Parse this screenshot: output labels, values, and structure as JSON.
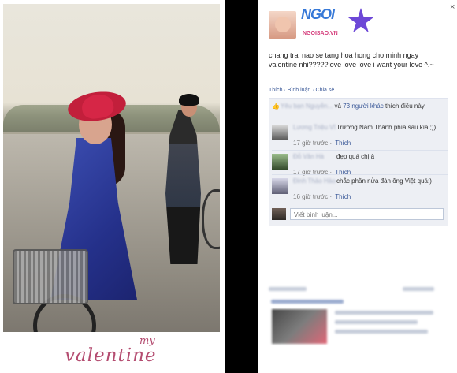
{
  "caption": {
    "small": "my",
    "main": "valentine"
  },
  "facebook_post": {
    "close_icon": "×",
    "logo_text": "NGOI",
    "logo_url": "NGOISAO.VN",
    "post_text": "chang trai nao se tang hoa hong cho minh ngay valentine nhi?????love love love i want your love ^.~",
    "actions": "Thích · Bình luận · Chia sẻ",
    "like_icon": "👍",
    "likes": {
      "prefix": "Yêu bạn Nguyễn...",
      "middle": "và",
      "count": "73 người khác",
      "suffix": "thích điều này."
    },
    "comments": [
      {
        "name": "Lương Triệu Vĩ",
        "body": "Trương Nam Thành phía sau kìa ;))",
        "time": "17 giờ trước ·",
        "like": "Thích"
      },
      {
        "name": "Đỗ Văn Hà",
        "body": "đẹp quá chị à",
        "time": "17 giờ trước ·",
        "like": "Thích"
      },
      {
        "name": "Đinh Thảo Hảo",
        "body": "chắc phần nửa đàn ông Việt quá:)",
        "time": "16 giờ trước ·",
        "like": "Thích"
      }
    ],
    "comment_placeholder": "Viết bình luận..."
  },
  "colors": {
    "facebook_blue": "#3b5998",
    "caption_pink": "#b44c70",
    "logo_blue": "#3779d8",
    "logo_pink": "#d43a79"
  },
  "icons": {
    "close": "close-icon",
    "like": "thumbs-up-icon",
    "logo_star": "star-icon"
  }
}
